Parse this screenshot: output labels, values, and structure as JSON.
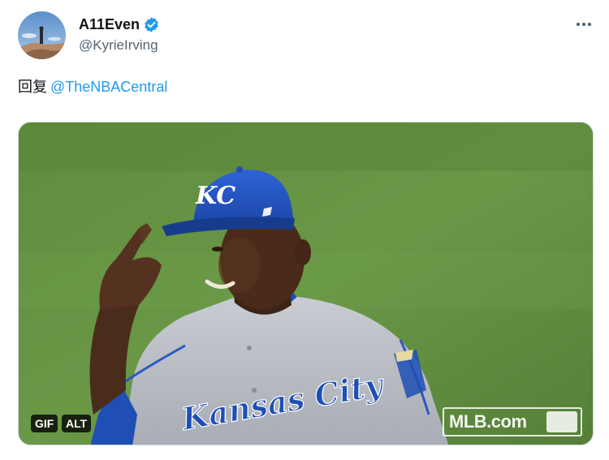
{
  "tweet": {
    "display_name": "A11Even",
    "handle": "@KyrieIrving",
    "verified": true,
    "reply_prefix": "回复",
    "mention": "@TheNBACentral",
    "more_icon": "more-horizontal-icon"
  },
  "media": {
    "type": "gif",
    "gif_badge": "GIF",
    "alt_badge": "ALT",
    "jersey_text": "Kansas City",
    "cap_logo": "KC",
    "watermark": "MLB.com"
  },
  "colors": {
    "accent": "#1d9bf0",
    "text_primary": "#0f1419",
    "text_secondary": "#536471",
    "field_green": "#5e8a3e",
    "royals_blue": "#1f4fb5"
  }
}
